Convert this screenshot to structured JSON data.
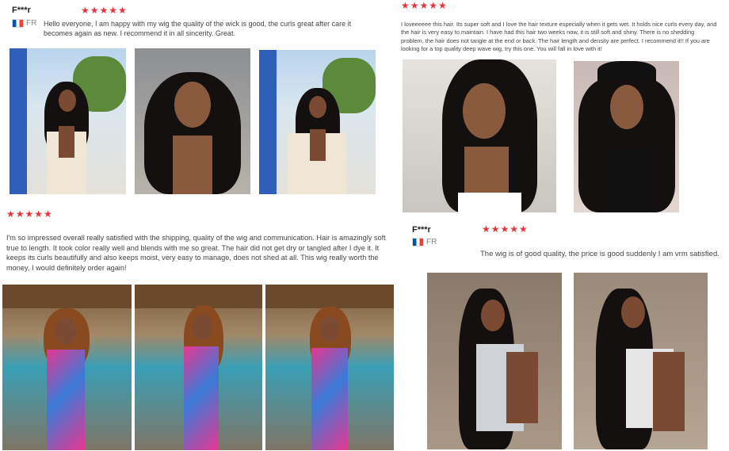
{
  "reviews": [
    {
      "user": "F***r",
      "country": "FR",
      "stars": "★★★★★",
      "text": "Hello everyone, I am happy with my wig the quality of the wick is good, the curls great after care it becomes again as new. I recommend it in all sincerity. Great."
    },
    {
      "stars": "★★★★★",
      "text": "I loveeeeee this hair. Its super soft and I love the hair texture especially when it gets wet. It holds nice curls every day, and the hair is very easy to maintain. I have had this hair two weeks now, it is still soft and shiny. There is no shedding problem, the hair does not tangle at the end or back. The hair length and density are perfect. I recommend it!! If you are looking for a top quality deep wave wig, try this one. You will fall in love with it!"
    },
    {
      "stars": "★★★★★",
      "text": "I'm so impressed overall really satisfied with the shipping, quality of the wig and communication. Hair is amazingly soft true to length. It took color really well and blends with me so great. The hair did not get dry or tangled after I dye it. It keeps its curls beautifully and also keeps moist, very easy to manage, does not shed at all. This wig really worth the money, I would definitely order again!"
    },
    {
      "user": "F***r",
      "country": "FR",
      "stars": "★★★★★",
      "text": "The wig is of good quality, the price is good suddenly I am vrm satisfied."
    }
  ],
  "colors": {
    "star": "#e8323c",
    "hair": "#141010",
    "skin": "#7a4a33"
  }
}
